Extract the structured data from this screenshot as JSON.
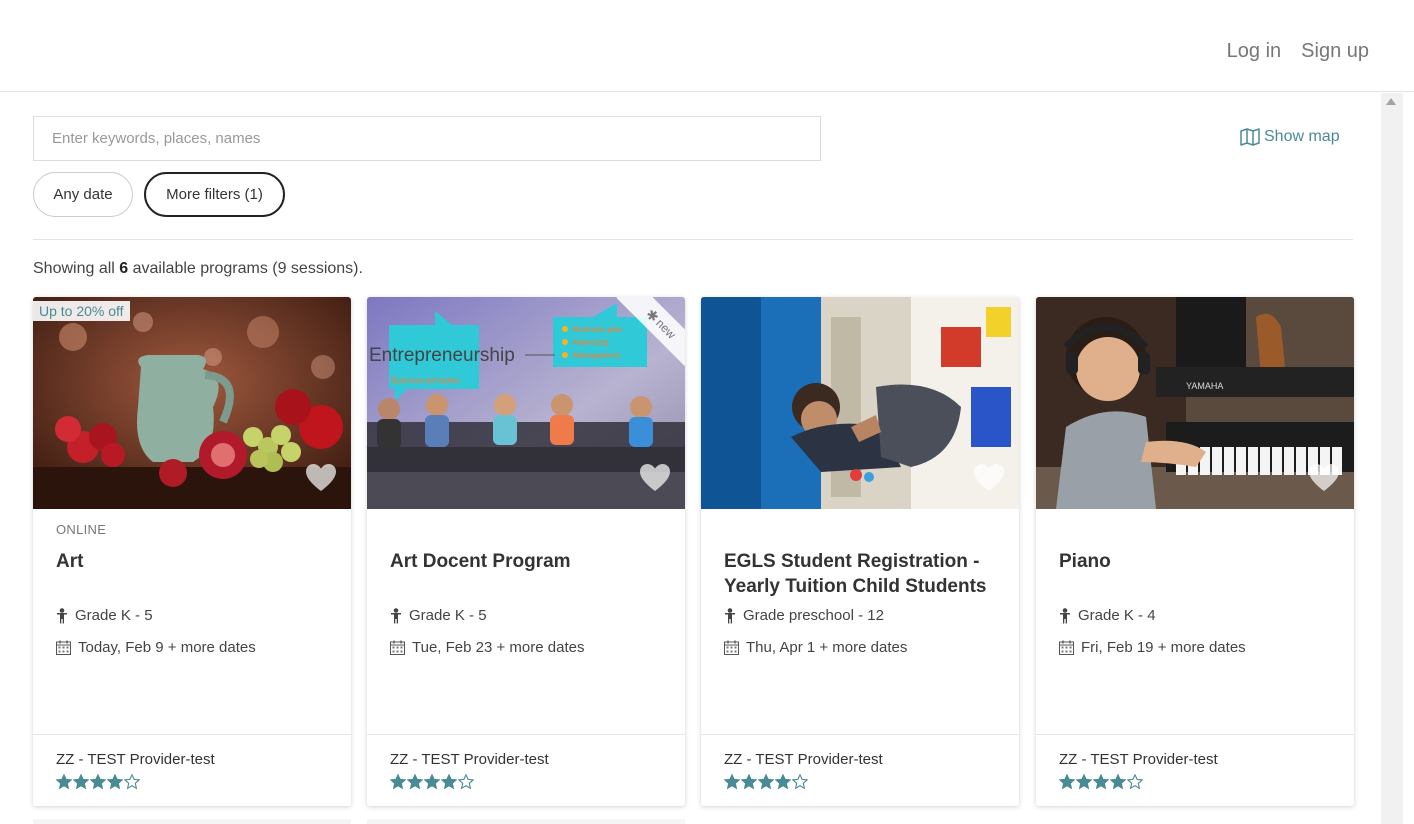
{
  "header": {
    "login": "Log in",
    "signup": "Sign up"
  },
  "search": {
    "placeholder": "Enter keywords, places, names",
    "value": ""
  },
  "show_map": "Show map",
  "filters": {
    "any_date": "Any date",
    "more_filters": "More filters (1)"
  },
  "summary": {
    "prefix": "Showing all ",
    "count": "6",
    "suffix": " available programs (9 sessions)."
  },
  "colors": {
    "accent": "#4a8a95",
    "star": "#4a8a95"
  },
  "cards": [
    {
      "badge": "Up to 20% off",
      "kicker": "ONLINE",
      "title": "Art",
      "grade": "Grade K - 5",
      "date": "Today, Feb 9 + more dates",
      "provider": "ZZ - TEST Provider-test",
      "rating": 4
    },
    {
      "ribbon": "new",
      "kicker": "",
      "title": "Art Docent Program",
      "grade": "Grade K - 5",
      "date": "Tue, Feb 23 + more dates",
      "provider": "ZZ - TEST Provider-test",
      "rating": 4,
      "image_text": {
        "word": "Entrepreneurship",
        "sub": "Business principles",
        "bullets": [
          "Business plan",
          "Marketing",
          "Management"
        ]
      }
    },
    {
      "kicker": "",
      "title": "EGLS Student Registration - Yearly Tuition Child Students",
      "grade": "Grade preschool - 12",
      "date": "Thu, Apr 1 + more dates",
      "provider": "ZZ - TEST Provider-test",
      "rating": 4
    },
    {
      "kicker": "",
      "title": "Piano",
      "grade": "Grade K - 4",
      "date": "Fri, Feb 19 + more dates",
      "provider": "ZZ - TEST Provider-test",
      "rating": 4,
      "image_text": {
        "brand": "YAMAHA"
      }
    }
  ]
}
